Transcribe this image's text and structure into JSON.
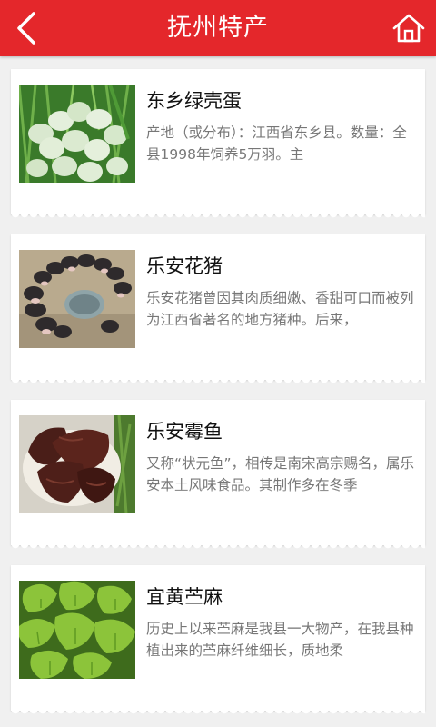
{
  "header": {
    "title": "抚州特产",
    "back_icon": "back-arrow-icon",
    "home_icon": "home-icon",
    "background": "#e4272b"
  },
  "items": [
    {
      "title": "东乡绿壳蛋",
      "description": "产地（或分布）：江西省东乡县。数量：全县1998年饲养5万羽。主",
      "image": "green-shell-eggs-photo"
    },
    {
      "title": "乐安花猪",
      "description": "乐安花猪曾因其肉质细嫩、香甜可口而被列为江西省著名的地方猪种。后来，",
      "image": "spotted-piglets-photo"
    },
    {
      "title": "乐安霉鱼",
      "description": "又称“状元鱼”，相传是南宋高宗赐名，属乐安本土风味食品。其制作多在冬季",
      "image": "fermented-fish-photo"
    },
    {
      "title": "宜黄苎麻",
      "description": "历史上以来苎麻是我县一大物产，在我县种植出来的苎麻纤维细长，质地柔",
      "image": "ramie-leaves-photo"
    }
  ]
}
